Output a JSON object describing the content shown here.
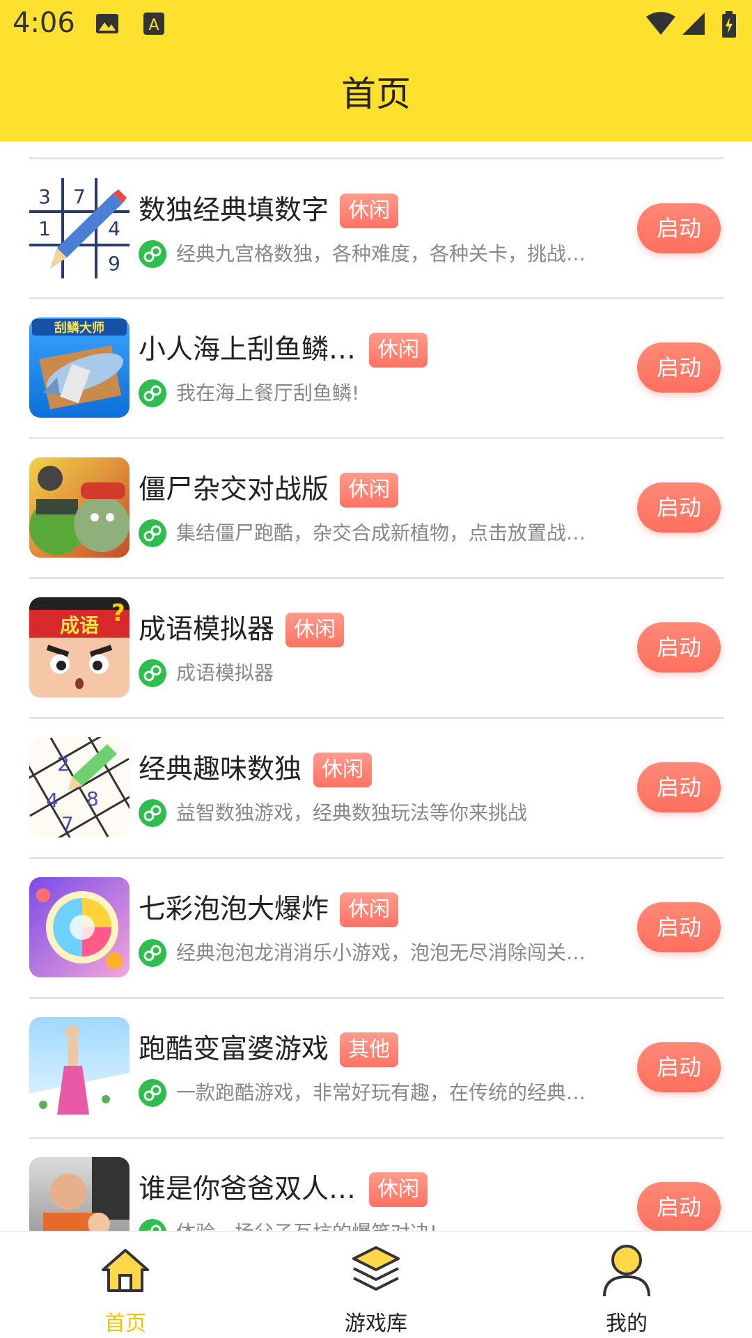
{
  "status_bar": {
    "time": "4:06"
  },
  "header": {
    "title": "首页"
  },
  "games": [
    {
      "name": "数独经典填数字",
      "tag": "休闲",
      "desc": "经典九宫格数独，各种难度，各种关卡，挑战…",
      "button": "启动",
      "icon": "sudoku-pencil-icon"
    },
    {
      "name": "小人海上刮鱼鳞…",
      "tag": "休闲",
      "desc": "我在海上餐厅刮鱼鳞!",
      "button": "启动",
      "icon": "fish-scaling-icon",
      "icon_text": "刮鳞大师"
    },
    {
      "name": "僵尸杂交对战版",
      "tag": "休闲",
      "desc": "集结僵尸跑酷，杂交合成新植物，点击放置战…",
      "button": "启动",
      "icon": "zombie-plant-icon"
    },
    {
      "name": "成语模拟器",
      "tag": "休闲",
      "desc": "成语模拟器",
      "button": "启动",
      "icon": "idiom-face-icon",
      "icon_text": "成语"
    },
    {
      "name": "经典趣味数独",
      "tag": "休闲",
      "desc": "益智数独游戏，经典数独玩法等你来挑战",
      "button": "启动",
      "icon": "fun-sudoku-icon"
    },
    {
      "name": "七彩泡泡大爆炸",
      "tag": "休闲",
      "desc": "经典泡泡龙消消乐小游戏，泡泡无尽消除闯关…",
      "button": "启动",
      "icon": "rainbow-bubble-icon"
    },
    {
      "name": "跑酷变富婆游戏",
      "tag": "其他",
      "desc": "一款跑酷游戏，非常好玩有趣，在传统的经典…",
      "button": "启动",
      "icon": "runway-lady-icon"
    },
    {
      "name": "谁是你爸爸双人…",
      "tag": "休闲",
      "desc": "体验一场父子互坑的爆笑对决!",
      "button": "启动",
      "icon": "dad-baby-icon"
    }
  ],
  "bottom_nav": [
    {
      "label": "首页",
      "icon": "home-icon",
      "active": true
    },
    {
      "label": "游戏库",
      "icon": "layers-icon",
      "active": false
    },
    {
      "label": "我的",
      "icon": "user-icon",
      "active": false
    }
  ],
  "colors": {
    "header": "#FEE12F",
    "accent": "#FF7263",
    "mini_badge": "#2DBE4E",
    "nav_active": "#F5C400"
  }
}
